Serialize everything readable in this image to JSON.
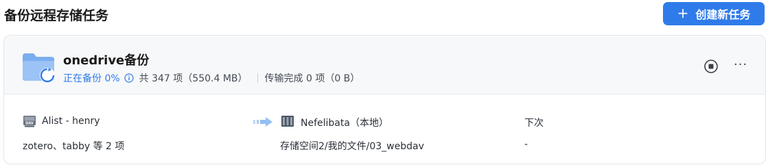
{
  "header": {
    "title": "备份远程存储任务",
    "create_button": {
      "icon": "plus-icon",
      "label": "创建新任务",
      "color": "#2f7bea"
    }
  },
  "task": {
    "name": "onedrive备份",
    "folder_icon": "folder-sync-icon",
    "status": "正在备份 0%",
    "total": "共 347 项（550.4 MB）",
    "transferred": "传输完成 0 项（0 B）",
    "actions": {
      "stop_icon": "stop-icon",
      "more_icon": "more-icon",
      "more_label": "···"
    },
    "source": {
      "icon": "dav-drive-icon",
      "name": "Alist - henry",
      "items": "zotero、tabby 等 2 项"
    },
    "transfer_arrow": "arrow-right-icon",
    "destination": {
      "icon": "nas-server-icon",
      "name": "Nefelibata（本地）",
      "path": "存储空间2/我的文件/03_webdav"
    },
    "next_run": {
      "label": "下次",
      "value": "-"
    }
  },
  "colors": {
    "accent": "#2f7bea",
    "card_header_bg": "#f7f8fa",
    "border": "#e3e6ea"
  }
}
